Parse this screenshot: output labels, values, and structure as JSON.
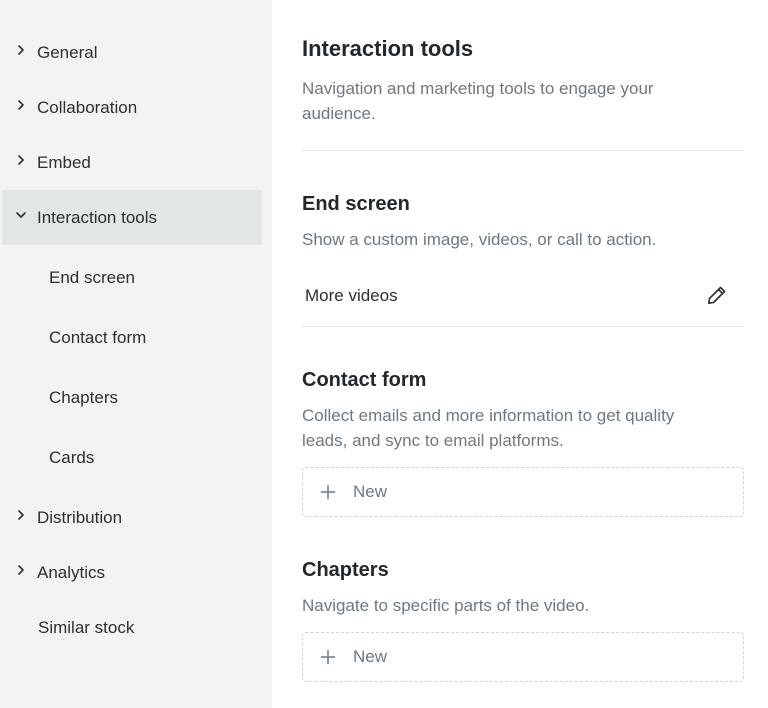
{
  "sidebar": {
    "items": [
      {
        "label": "General"
      },
      {
        "label": "Collaboration"
      },
      {
        "label": "Embed"
      },
      {
        "label": "Interaction tools"
      },
      {
        "label": "End screen"
      },
      {
        "label": "Contact form"
      },
      {
        "label": "Chapters"
      },
      {
        "label": "Cards"
      },
      {
        "label": "Distribution"
      },
      {
        "label": "Analytics"
      },
      {
        "label": "Similar stock"
      }
    ]
  },
  "main": {
    "title": "Interaction tools",
    "description": "Navigation and marketing tools to engage your audience.",
    "end_screen": {
      "heading": "End screen",
      "description": "Show a custom image, videos, or call to action.",
      "value": "More videos"
    },
    "contact_form": {
      "heading": "Contact form",
      "description": "Collect emails and more information to get quality leads, and sync to email platforms.",
      "new_label": "New"
    },
    "chapters": {
      "heading": "Chapters",
      "description": "Navigate to specific parts of the video.",
      "new_label": "New"
    }
  },
  "icons": {
    "collapsed": "chevron-right-icon",
    "expanded": "chevron-down-icon",
    "edit": "pencil-icon",
    "add": "plus-icon"
  },
  "colors": {
    "sidebar_bg": "#f1f3f4",
    "active_bg": "#e2e6e7",
    "text": "#22272b",
    "muted": "#6d7880"
  }
}
